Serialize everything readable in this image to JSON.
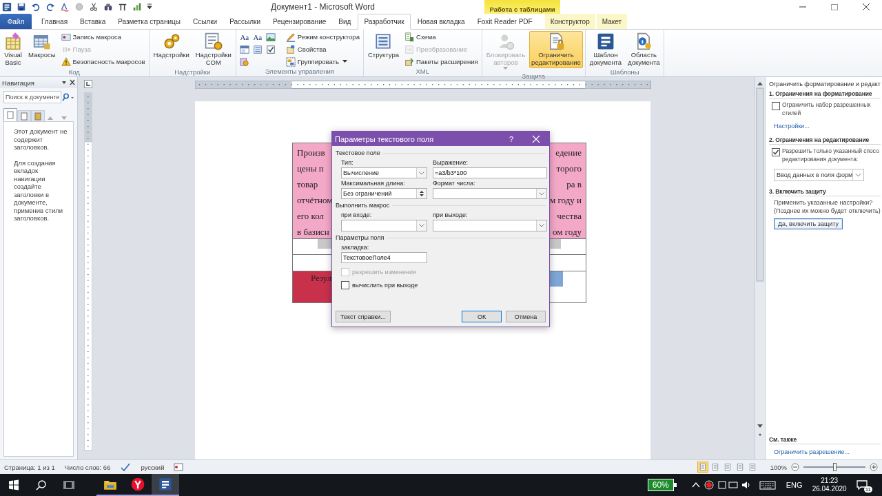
{
  "title_bar": {
    "title": "Документ1 - Microsoft Word"
  },
  "context_group": {
    "label": "Работа с таблицами"
  },
  "tabs": [
    {
      "label": "Файл",
      "kind": "file",
      "selected": false
    },
    {
      "label": "Главная",
      "kind": "tab",
      "selected": false
    },
    {
      "label": "Вставка",
      "kind": "tab",
      "selected": false
    },
    {
      "label": "Разметка страницы",
      "kind": "tab",
      "selected": false
    },
    {
      "label": "Ссылки",
      "kind": "tab",
      "selected": false
    },
    {
      "label": "Рассылки",
      "kind": "tab",
      "selected": false
    },
    {
      "label": "Рецензирование",
      "kind": "tab",
      "selected": false
    },
    {
      "label": "Вид",
      "kind": "tab",
      "selected": false
    },
    {
      "label": "Разработчик",
      "kind": "tab",
      "selected": true
    },
    {
      "label": "Новая вкладка",
      "kind": "tab",
      "selected": false
    },
    {
      "label": "Foxit Reader PDF",
      "kind": "tab",
      "selected": false
    },
    {
      "label": "Конструктор",
      "kind": "context",
      "selected": false
    },
    {
      "label": "Макет",
      "kind": "context",
      "selected": false
    }
  ],
  "ribbon": [
    {
      "label": "Код",
      "large": [
        {
          "label": "Visual Basic",
          "disabled": false,
          "pressed": false,
          "dropdown": false
        },
        {
          "label": "Макросы",
          "disabled": false,
          "pressed": false,
          "dropdown": false
        }
      ],
      "small": [
        {
          "label": "Запись макроса",
          "disabled": false,
          "dropdown": false
        },
        {
          "label": "Пауза",
          "disabled": true,
          "dropdown": false
        },
        {
          "label": "Безопасность макросов",
          "disabled": false,
          "dropdown": false
        }
      ]
    },
    {
      "label": "Надстройки",
      "large": [
        {
          "label": "Надстройки",
          "disabled": false,
          "pressed": false,
          "dropdown": false
        },
        {
          "label": "Надстройки COM",
          "disabled": false,
          "pressed": false,
          "dropdown": false
        }
      ]
    },
    {
      "label": "Элементы управления",
      "glyphs": [
        "Aa",
        "Aa"
      ],
      "small": [
        {
          "label": "Режим конструктора",
          "disabled": false,
          "dropdown": false
        },
        {
          "label": "Свойства",
          "disabled": false,
          "dropdown": false
        },
        {
          "label": "Группировать",
          "disabled": false,
          "dropdown": true
        }
      ]
    },
    {
      "label": "XML",
      "large": [
        {
          "label": "Структура",
          "disabled": false,
          "pressed": false,
          "dropdown": false
        }
      ],
      "small": [
        {
          "label": "Схема",
          "disabled": false,
          "dropdown": false
        },
        {
          "label": "Преобразование",
          "disabled": true,
          "dropdown": false
        },
        {
          "label": "Пакеты расширения",
          "disabled": false,
          "dropdown": false
        }
      ]
    },
    {
      "label": "Защита",
      "large": [
        {
          "label": "Блокировать авторов",
          "disabled": true,
          "pressed": false,
          "dropdown": true
        },
        {
          "label": "Ограничить редактирование",
          "disabled": false,
          "pressed": true,
          "dropdown": false
        }
      ]
    },
    {
      "label": "Шаблоны",
      "large": [
        {
          "label": "Шаблон документа",
          "disabled": false,
          "pressed": false,
          "dropdown": false
        },
        {
          "label": "Область документа",
          "disabled": false,
          "pressed": false,
          "dropdown": false
        }
      ]
    }
  ],
  "navigation": {
    "title": "Навигация",
    "search": {
      "placeholder": "Поиск в документе"
    },
    "tabs": [
      {
        "selected": true
      },
      {
        "selected": false
      },
      {
        "selected": false
      }
    ],
    "messages": [
      "Этот документ не содержит заголовков.",
      "Для создания вкладок навигации создайте заголовки в документе, применив стили заголовков."
    ]
  },
  "document": {
    "table": {
      "header_left": [
        "Произв",
        "цены п",
        "товар",
        "отчётном",
        "его кол",
        "в базисн"
      ],
      "header_right": [
        "едение",
        "торого",
        "ра в",
        "м году и",
        "чества",
        "ом году"
      ],
      "result_left": "Резул"
    }
  },
  "dialog": {
    "title": "Параметры текстового поля",
    "help": "?",
    "sections": [
      {
        "heading": "Текстовое поле"
      },
      {
        "heading": "Выполнить макрос"
      },
      {
        "heading": "Параметры поля"
      }
    ],
    "type": {
      "label": "Тип:",
      "value": "Вычисление"
    },
    "expression": {
      "label": "Выражение:",
      "value": "=а3/b3*100"
    },
    "max_length": {
      "label": "Максимальная длина:",
      "value": "Без ограничений"
    },
    "number_format": {
      "label": "Формат числа:"
    },
    "on_entry": {
      "label": "при входе:"
    },
    "on_exit": {
      "label": "при выходе:"
    },
    "bookmark": {
      "label": "закладка:",
      "value": "ТекстовоеПоле4"
    },
    "options": [
      {
        "label": "разрешить изменения",
        "checked": false,
        "disabled": true
      },
      {
        "label": "вычислить при выходе",
        "checked": false,
        "disabled": false
      }
    ],
    "buttons": [
      {
        "label": "Текст справки...",
        "selected": false
      },
      {
        "label": "ОК",
        "selected": true
      },
      {
        "label": "Отмена",
        "selected": false
      }
    ]
  },
  "task_pane": {
    "title": "Ограничить форматирование и редакт",
    "sections": [
      {
        "heading": "1. Ограничения на форматирование",
        "checkbox": {
          "lines": [
            "Ограничить набор разрешенных",
            "стилей"
          ],
          "checked": false
        },
        "link": "Настройки..."
      },
      {
        "heading": "2. Ограничения на редактирование",
        "checkbox": {
          "lines": [
            "Разрешить только указанный спосо",
            "редактирования документа:"
          ],
          "checked": true
        },
        "select": "Ввод данных в поля форм"
      },
      {
        "heading": "3. Включить защиту",
        "lines": [
          "Применить указанные настройки?",
          "(Позднее их можно будет отключить)"
        ],
        "button": "Да, включить защиту"
      }
    ],
    "see_also": {
      "heading": "См. также",
      "link": "Ограничить разрешение..."
    }
  },
  "status_bar": {
    "page": "Страница: 1 из 1",
    "words": "Число слов: 66",
    "language": "русский",
    "views": [
      {
        "selected": true
      },
      {
        "selected": false
      },
      {
        "selected": false
      },
      {
        "selected": false
      },
      {
        "selected": false
      }
    ],
    "zoom": "100%",
    "zoom_slider": {
      "level": 0.5
    }
  },
  "taskbar": {
    "apps": [
      {
        "running": true,
        "selected": false
      },
      {
        "running": true,
        "selected": false
      },
      {
        "running": true,
        "selected": true
      }
    ],
    "battery": "60%",
    "language": "ENG",
    "time": "21:23",
    "date": "26.04.2020",
    "notifications": "11"
  }
}
